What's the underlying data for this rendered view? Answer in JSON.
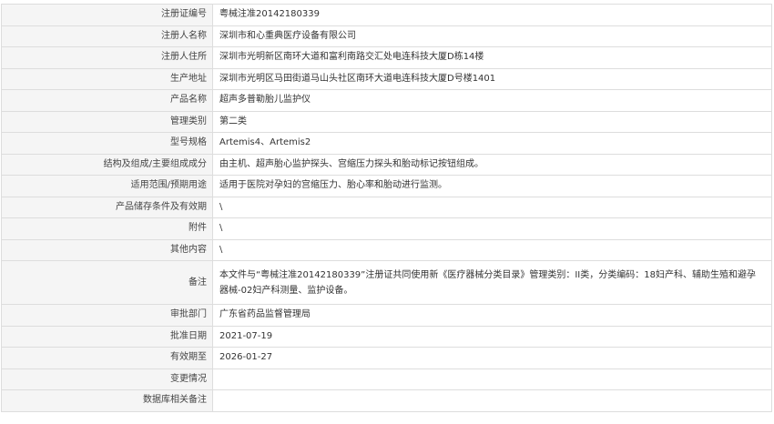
{
  "record": {
    "rows": [
      {
        "label": "注册证编号",
        "value": "粤械注准20142180339"
      },
      {
        "label": "注册人名称",
        "value": "深圳市和心重典医疗设备有限公司"
      },
      {
        "label": "注册人住所",
        "value": "深圳市光明新区南环大道和富利南路交汇处电连科技大厦D栋14楼"
      },
      {
        "label": "生产地址",
        "value": "深圳市光明区马田街道马山头社区南环大道电连科技大厦D号楼1401"
      },
      {
        "label": "产品名称",
        "value": "超声多普勒胎儿监护仪"
      },
      {
        "label": "管理类别",
        "value": "第二类"
      },
      {
        "label": "型号规格",
        "value": "Artemis4、Artemis2"
      },
      {
        "label": "结构及组成/主要组成成分",
        "value": "由主机、超声胎心监护探头、宫缩压力探头和胎动标记按钮组成。"
      },
      {
        "label": "适用范围/预期用途",
        "value": "适用于医院对孕妇的宫缩压力、胎心率和胎动进行监测。"
      },
      {
        "label": "产品储存条件及有效期",
        "value": "\\"
      },
      {
        "label": "附件",
        "value": "\\"
      },
      {
        "label": "其他内容",
        "value": "\\"
      },
      {
        "label": "备注",
        "value": "本文件与“粤械注准20142180339”注册证共同使用新《医疗器械分类目录》管理类别：II类，分类编码：18妇产科、辅助生殖和避孕器械-02妇产科测量、监护设备。"
      },
      {
        "label": "审批部门",
        "value": "广东省药品监督管理局"
      },
      {
        "label": "批准日期",
        "value": "2021-07-19"
      },
      {
        "label": "有效期至",
        "value": "2026-01-27"
      },
      {
        "label": "变更情况",
        "value": ""
      },
      {
        "label": "数据库相关备注",
        "value": ""
      }
    ]
  }
}
